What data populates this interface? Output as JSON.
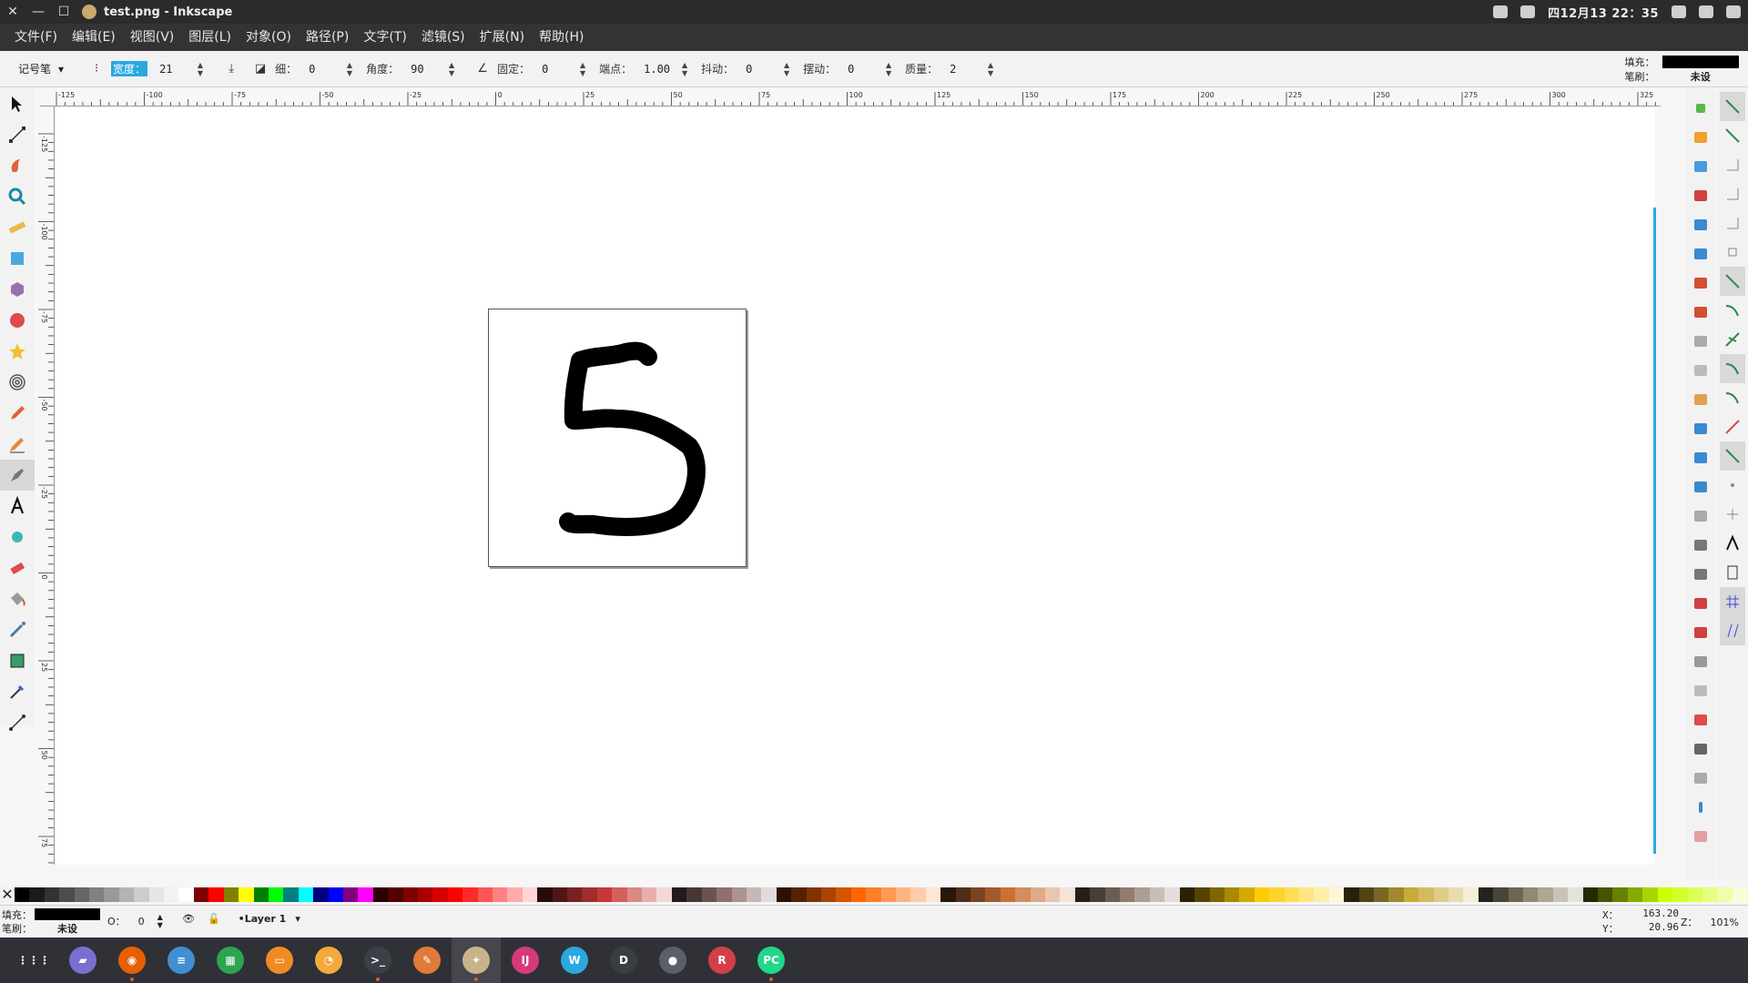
{
  "window": {
    "title": "test.png - Inkscape",
    "close_glyph": "✕",
    "minimize_glyph": "—",
    "maximize_glyph": "☐"
  },
  "tray": {
    "clock": "四12月13 22：35"
  },
  "menu": [
    "文件(F)",
    "编辑(E)",
    "视图(V)",
    "图层(L)",
    "对象(O)",
    "路径(P)",
    "文字(T)",
    "滤镜(S)",
    "扩展(N)",
    "帮助(H)"
  ],
  "tool_controls": {
    "preset_label": "记号笔",
    "width_label": "宽度：",
    "width_value": "21",
    "thinning_label": "细：",
    "thinning_value": "0",
    "angle_label": "角度：",
    "angle_value": "90",
    "fixation_label": "固定：",
    "fixation_value": "0",
    "caps_label": "端点：",
    "caps_value": "1.00",
    "tremor_label": "抖动：",
    "tremor_value": "0",
    "wiggle_label": "摆动：",
    "wiggle_value": "0",
    "mass_label": "质量：",
    "mass_value": "2",
    "fill_label": "填充：",
    "stroke_label": "笔刷：",
    "stroke_value": "未设"
  },
  "rulers": {
    "h_ticks": [
      "-125",
      "-100",
      "-75",
      "-50",
      "-25",
      "0",
      "25",
      "50",
      "75",
      "100",
      "125",
      "150",
      "175",
      "200",
      "225",
      "250",
      "275",
      "300",
      "325"
    ],
    "v_ticks": [
      "-125",
      "-100",
      "-75",
      "-50",
      "-25",
      "0",
      "25",
      "50",
      "75"
    ]
  },
  "canvas": {
    "drawing_stroke": "#000000"
  },
  "statusbar": {
    "fill_label": "填充：",
    "stroke_label": "笔刷：",
    "stroke_value": "未设",
    "opacity_label": "O：",
    "opacity_value": "0",
    "layer_name": "•Layer 1",
    "x_label": "X：",
    "x_value": "163.20",
    "y_label": "Y：",
    "y_value": "20.96",
    "zoom_label": "Z：",
    "zoom_value": "101%"
  },
  "palette": {
    "nocolor_glyph": "✕",
    "colors": [
      "#000000",
      "#1a1a1a",
      "#333333",
      "#4d4d4d",
      "#666666",
      "#808080",
      "#999999",
      "#b3b3b3",
      "#cccccc",
      "#e6e6e6",
      "#f2f2f2",
      "#ffffff",
      "#800000",
      "#ff0000",
      "#808000",
      "#ffff00",
      "#008000",
      "#00ff00",
      "#008080",
      "#00ffff",
      "#000080",
      "#0000ff",
      "#800080",
      "#ff00ff",
      "#2b0000",
      "#550000",
      "#800000",
      "#aa0000",
      "#d40000",
      "#ff0000",
      "#ff2a2a",
      "#ff5555",
      "#ff8080",
      "#ffaaaa",
      "#ffd5d5",
      "#280b0b",
      "#501616",
      "#782121",
      "#a02c2c",
      "#c83737",
      "#d35f5f",
      "#de8787",
      "#e9afaf",
      "#f4d7d7",
      "#241c1c",
      "#483737",
      "#6c5353",
      "#916f6f",
      "#ac9393",
      "#c8b7b7",
      "#e3dbdb",
      "#2b1100",
      "#552200",
      "#803300",
      "#aa4400",
      "#d45500",
      "#ff6600",
      "#ff7f2a",
      "#ff9955",
      "#ffb380",
      "#ffccaa",
      "#ffe6d5",
      "#28170b",
      "#502d16",
      "#784421",
      "#a05a2c",
      "#c87137",
      "#d38d5f",
      "#deaa87",
      "#e9c6af",
      "#f4e3d7",
      "#241f1c",
      "#483e37",
      "#6c5d53",
      "#917c6f",
      "#ac9d93",
      "#c8beb7",
      "#e3dedb",
      "#2b2200",
      "#554400",
      "#806600",
      "#aa8800",
      "#d4aa00",
      "#ffcc00",
      "#ffd42a",
      "#ffdd55",
      "#ffe680",
      "#ffeeaa",
      "#fff6d5",
      "#28220b",
      "#504416",
      "#786721",
      "#a0892c",
      "#c8ab37",
      "#d3bc5f",
      "#decd87",
      "#e9ddaf",
      "#f4eed7",
      "#24221c",
      "#484537",
      "#6c6753",
      "#918a6f",
      "#aca793",
      "#c8c4b7",
      "#e3e2db",
      "#222b00",
      "#445500",
      "#668000",
      "#88aa00",
      "#aad400",
      "#ccff00",
      "#d4ff2a",
      "#ddff55",
      "#e5ff80",
      "#eeffaa",
      "#f6ffd5"
    ]
  },
  "dock": [
    {
      "name": "launcher",
      "color": "#2f3136",
      "glyph": "⋮⋮⋮"
    },
    {
      "name": "files",
      "color": "#7a6fd0",
      "glyph": "▰"
    },
    {
      "name": "firefox",
      "color": "#e66000",
      "glyph": "◉"
    },
    {
      "name": "docs",
      "color": "#3f8fd2",
      "glyph": "≡"
    },
    {
      "name": "sheets",
      "color": "#2ea44f",
      "glyph": "▦"
    },
    {
      "name": "slides",
      "color": "#f08a24",
      "glyph": "▭"
    },
    {
      "name": "draw",
      "color": "#f3a93b",
      "glyph": "◔"
    },
    {
      "name": "terminal",
      "color": "#3b3f46",
      "glyph": ">_"
    },
    {
      "name": "editor",
      "color": "#e07b39",
      "glyph": "✎"
    },
    {
      "name": "inkscape",
      "color": "#c9b48a",
      "glyph": "✦"
    },
    {
      "name": "intellij",
      "color": "#d63a7a",
      "glyph": "IJ"
    },
    {
      "name": "webstorm",
      "color": "#2aa9e0",
      "glyph": "W"
    },
    {
      "name": "deepin",
      "color": "#3a3d44",
      "glyph": "D"
    },
    {
      "name": "camera",
      "color": "#5b5e66",
      "glyph": "●"
    },
    {
      "name": "rstudio",
      "color": "#d33f49",
      "glyph": "R"
    },
    {
      "name": "pycharm",
      "color": "#21d789",
      "glyph": "PC"
    }
  ]
}
